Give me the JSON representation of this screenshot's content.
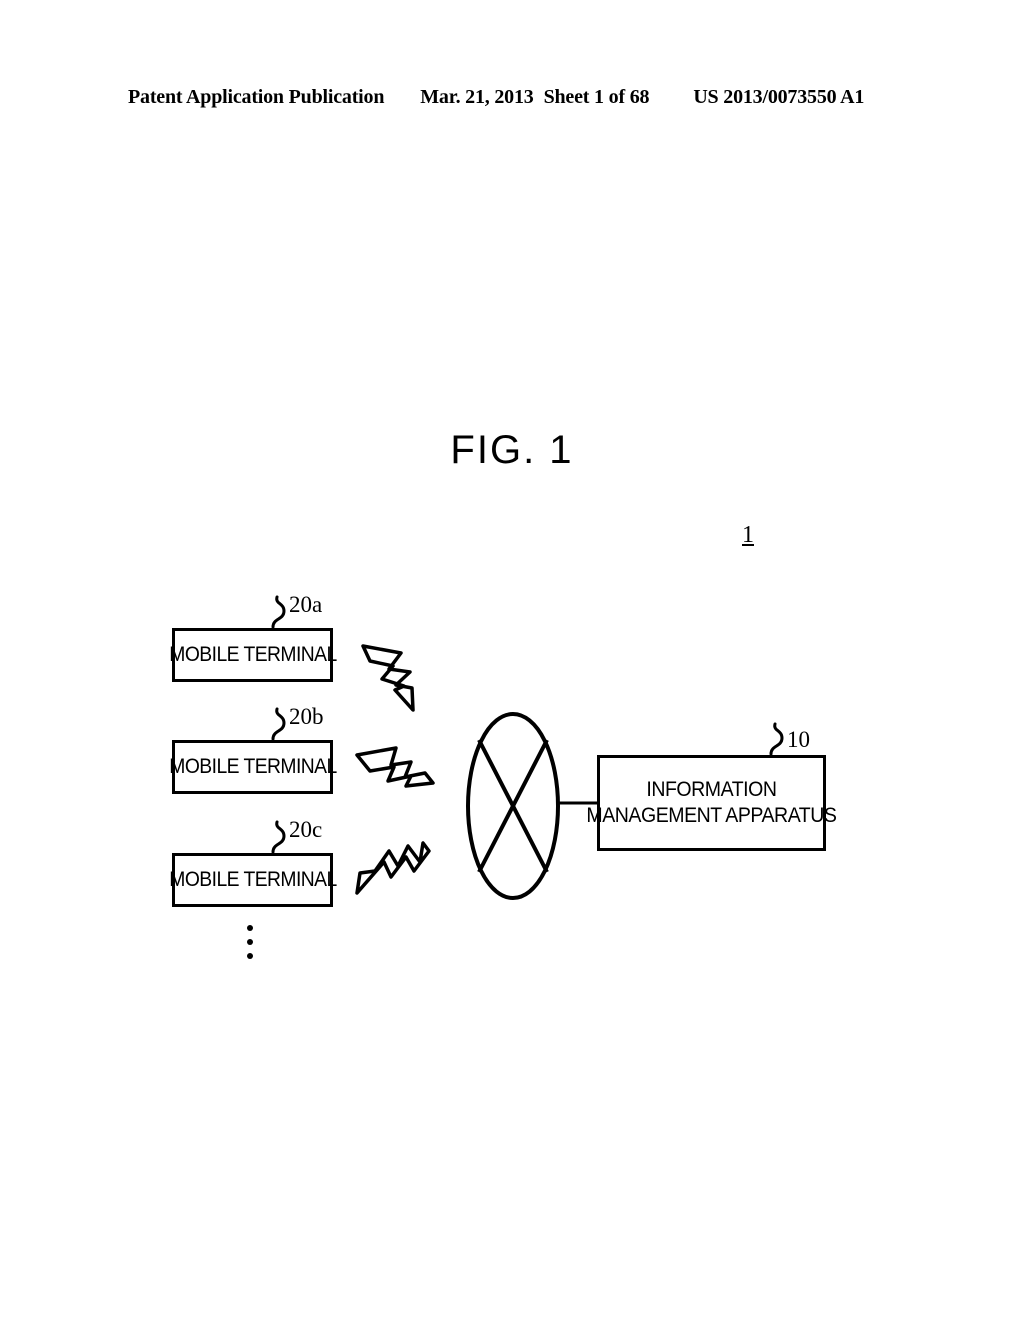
{
  "page": {
    "header": {
      "publication": "Patent Application Publication",
      "date": "Mar. 21, 2013",
      "sheet": "Sheet 1 of 68",
      "doc_number": "US 2013/0073550 A1"
    },
    "figure_title": "FIG.  1",
    "system_reference": "1"
  },
  "diagram": {
    "nodes": [
      {
        "id": "20a",
        "label": "MOBILE TERMINAL",
        "ref": "20a"
      },
      {
        "id": "20b",
        "label": "MOBILE TERMINAL",
        "ref": "20b"
      },
      {
        "id": "20c",
        "label": "MOBILE TERMINAL",
        "ref": "20c"
      }
    ],
    "apparatus": {
      "ref": "10",
      "label_line1": "INFORMATION",
      "label_line2": "MANAGEMENT APPARATUS"
    },
    "network": {
      "symbol": "network-ellipse-crossed",
      "label": ""
    },
    "continuation": "⋮",
    "wireless_links": [
      {
        "from": "20a",
        "to": "network",
        "symbol": "lightning-bolt"
      },
      {
        "from": "20b",
        "to": "network",
        "symbol": "lightning-bolt"
      },
      {
        "from": "20c",
        "to": "network",
        "symbol": "lightning-bolt"
      }
    ],
    "wired_links": [
      {
        "from": "network",
        "to": "10",
        "symbol": "line"
      }
    ],
    "colors": {
      "ink": "#000000",
      "paper": "#ffffff"
    }
  }
}
